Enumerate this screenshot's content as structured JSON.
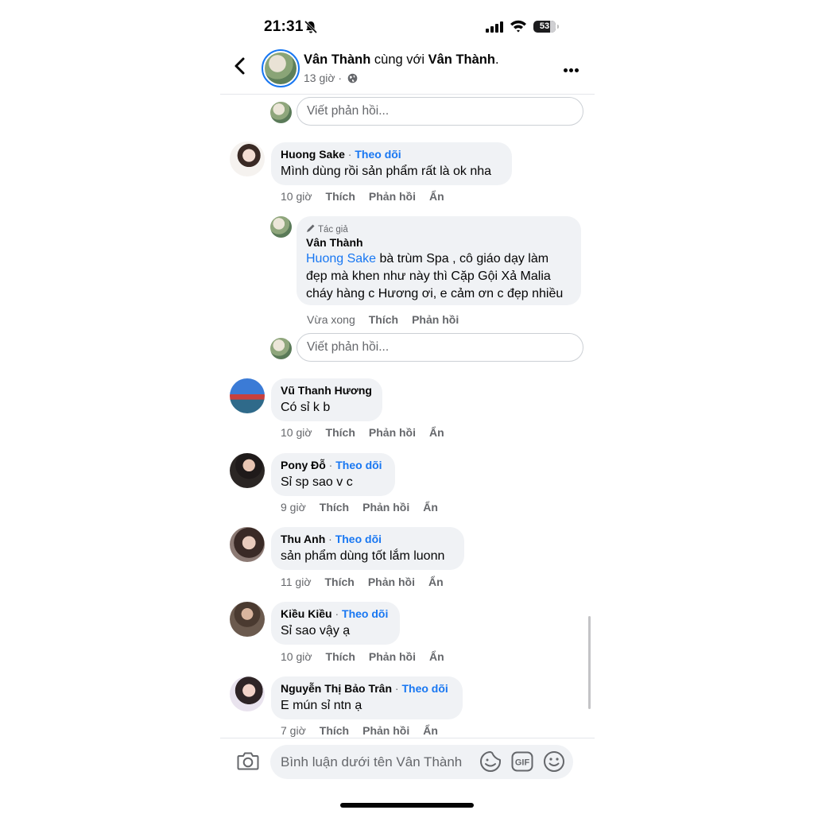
{
  "status_bar": {
    "time": "21:31",
    "battery": "53"
  },
  "header": {
    "title_name1": "Vân Thành",
    "title_mid": " cùng với ",
    "title_name2": "Vân Thành",
    "title_end": ".",
    "time": "13 giờ · "
  },
  "reply_placeholder": "Viết phản hồi...",
  "comments": [
    {
      "name": "Huong Sake",
      "follow": "Theo dõi",
      "text": "Mình dùng rồi sản phẩm rất là ok nha",
      "time": "10 giờ",
      "like": "Thích",
      "reply": "Phản hồi",
      "hide": "Ẩn"
    },
    {
      "name": "Vũ Thanh Hương",
      "text": "Có sỉ k b",
      "time": "10 giờ",
      "like": "Thích",
      "reply": "Phản hồi",
      "hide": "Ẩn"
    },
    {
      "name": "Pony Đỗ",
      "follow": "Theo dõi",
      "text": "Sỉ sp sao v c",
      "time": "9 giờ",
      "like": "Thích",
      "reply": "Phản hồi",
      "hide": "Ẩn"
    },
    {
      "name": "Thu Anh",
      "follow": "Theo dõi",
      "text": "sản phẩm dùng tốt lắm luonn",
      "time": "11 giờ",
      "like": "Thích",
      "reply": "Phản hồi",
      "hide": "Ẩn"
    },
    {
      "name": "Kiều Kiều",
      "follow": "Theo dõi",
      "text": "Sỉ sao vậy ạ",
      "time": "10 giờ",
      "like": "Thích",
      "reply": "Phản hồi",
      "hide": "Ẩn"
    },
    {
      "name": "Nguyễn Thị Bảo Trân",
      "follow": "Theo dõi",
      "text": "E mún sỉ ntn ạ",
      "time": "7 giờ",
      "like": "Thích",
      "reply": "Phản hồi",
      "hide": "Ẩn"
    }
  ],
  "author_reply": {
    "tag": "Tác giả",
    "name": "Vân Thành",
    "mention": "Huong Sake",
    "text_line1": " bà trùm Spa , cô giáo dạy làm",
    "text_line2": "đẹp mà khen như này thì Cặp Gội Xả Malia",
    "text_line3": "cháy hàng c Hương ơi, e cảm ơn c đẹp nhiều",
    "time": "Vừa xong",
    "like": "Thích",
    "reply": "Phản hồi"
  },
  "composer": {
    "placeholder": "Bình luận dưới tên Vân Thành"
  },
  "colors": {
    "accent": "#1877f2",
    "bubble": "#f0f2f5",
    "muted": "#65676b"
  },
  "icons": [
    "bell-off-icon",
    "signal-icon",
    "wifi-icon",
    "battery-icon",
    "back-arrow-icon",
    "globe-icon",
    "more-icon",
    "pencil-icon",
    "camera-icon",
    "sticker-icon",
    "gif-icon",
    "emoji-icon"
  ]
}
